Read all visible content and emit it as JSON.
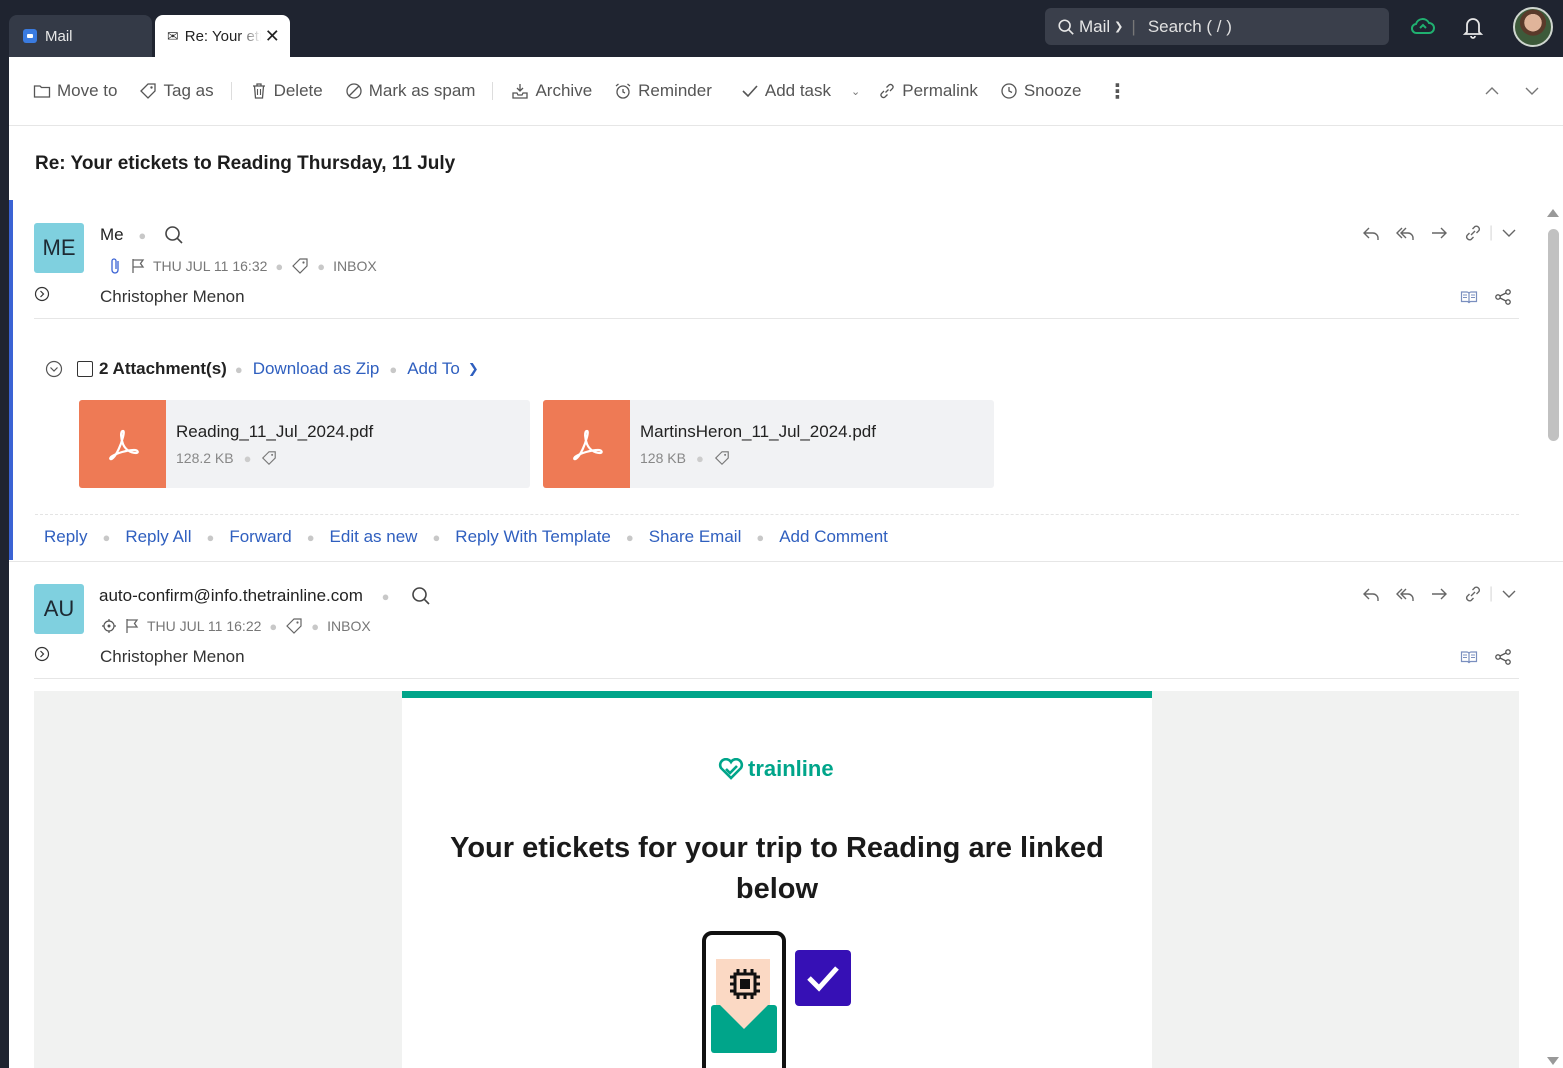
{
  "tabs": [
    {
      "label": "Mail",
      "icon": "mail-app-icon"
    },
    {
      "label": "Re: Your etickets",
      "icon": "envelope-open-icon"
    }
  ],
  "search": {
    "scope": "Mail",
    "placeholder": "Search ( / )"
  },
  "toolbar": {
    "move_to": "Move to",
    "tag_as": "Tag as",
    "delete": "Delete",
    "mark_as_spam": "Mark as spam",
    "archive": "Archive",
    "reminder": "Reminder",
    "add_task": "Add task",
    "permalink": "Permalink",
    "snooze": "Snooze"
  },
  "subject": "Re: Your etickets to Reading Thursday, 11 July",
  "messages": [
    {
      "initials": "ME",
      "sender": "Me",
      "date": "THU JUL 11 16:32",
      "folder": "INBOX",
      "to": "Christopher Menon"
    },
    {
      "initials": "AU",
      "sender": "auto-confirm@info.thetrainline.com",
      "date": "THU JUL 11 16:22",
      "folder": "INBOX",
      "to": "Christopher Menon"
    }
  ],
  "attachments": {
    "count_label": "2 Attachment(s)",
    "download_zip": "Download as Zip",
    "add_to": "Add To",
    "files": [
      {
        "name": "Reading_11_Jul_2024.pdf",
        "size": "128.2 KB"
      },
      {
        "name": "MartinsHeron_11_Jul_2024.pdf",
        "size": "128 KB"
      }
    ]
  },
  "reply_actions": [
    "Reply",
    "Reply All",
    "Forward",
    "Edit as new",
    "Reply With Template",
    "Share Email",
    "Add Comment"
  ],
  "email_body": {
    "logo_text": "trainline",
    "headline": "Your etickets for your trip to Reading are linked below"
  },
  "colors": {
    "accent": "#2f5fbf",
    "trainline_green": "#00a58a",
    "pdf_orange": "#ee7a55",
    "avatar_bg": "#7fd0df",
    "selection_bar": "#3b63d4"
  }
}
